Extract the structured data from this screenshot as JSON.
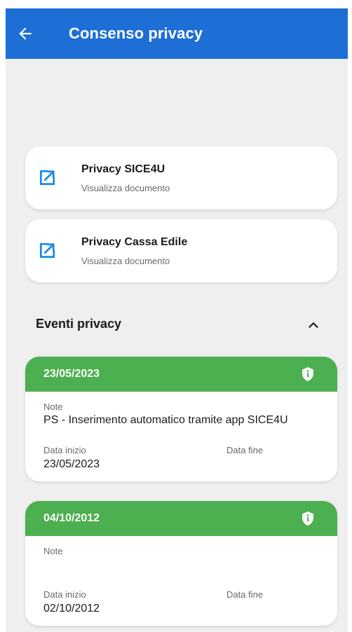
{
  "appbar": {
    "title": "Consenso privacy",
    "back_icon": "arrow-left-icon",
    "color": "#1d6fd6"
  },
  "documents": [
    {
      "title": "Privacy SICE4U",
      "subtitle": "Visualizza documento",
      "icon": "open-external-icon"
    },
    {
      "title": "Privacy Cassa Edile",
      "subtitle": "Visualizza documento",
      "icon": "open-external-icon"
    }
  ],
  "events_section": {
    "title": "Eventi privacy",
    "toggle_icon": "chevron-up-icon"
  },
  "events": [
    {
      "date": "23/05/2023",
      "note_label": "Note",
      "note": "PS - Inserimento automatico tramite app SICE4U",
      "start_label": "Data inizio",
      "start": "23/05/2023",
      "end_label": "Data fine",
      "end": ""
    },
    {
      "date": "04/10/2012",
      "note_label": "Note",
      "note": "",
      "start_label": "Data inizio",
      "start": "02/10/2012",
      "end_label": "Data fine",
      "end": ""
    }
  ],
  "colors": {
    "primary": "#1d6fd6",
    "success": "#4caf50",
    "background": "#efefef"
  }
}
